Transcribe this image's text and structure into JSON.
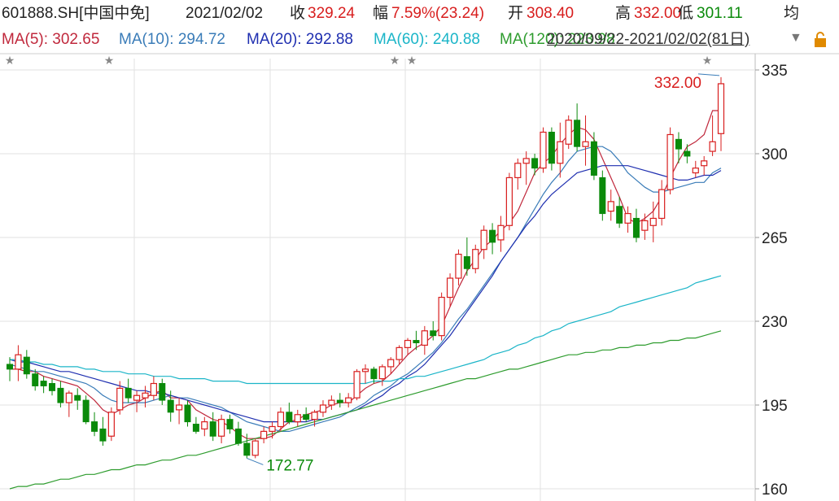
{
  "header": {
    "code": "601888.SH[中国中免]",
    "date": "2021/02/02",
    "close_label": "收",
    "close": "329.24",
    "change_label": "幅",
    "change": "7.59%(23.24)",
    "open_label": "开",
    "open": "308.40",
    "high_label": "高",
    "high": "332.00",
    "low_label": "低",
    "low": "301.11",
    "avg_label": "均"
  },
  "ma_legend": {
    "ma5": "MA(5): 302.65",
    "ma10": "MA(10): 294.72",
    "ma20": "MA(20): 292.88",
    "ma60": "MA(60): 240.88",
    "ma120": "MA(120): 223.98",
    "range": "2020/09/22-2021/02/02(81日)"
  },
  "colors": {
    "up": "#d81e1e",
    "down": "#0a8a0a",
    "ma5": "#c0283c",
    "ma10": "#3a7cb8",
    "ma20": "#1f2fb0",
    "ma60": "#1bb5c8",
    "ma120": "#2e9c2e",
    "grid": "#e2e2e2"
  },
  "icons": {
    "dropdown": "triangle-down-icon",
    "lock": "lock-icon",
    "star": "star-icon"
  },
  "chart_data": {
    "type": "candlestick",
    "ylim": [
      160,
      335
    ],
    "yticks": [
      "335",
      "300",
      "265",
      "230",
      "195",
      "160"
    ],
    "high_annotation": "332.00",
    "low_annotation": "172.77",
    "candles": [
      [
        212,
        215,
        205,
        210
      ],
      [
        210,
        220,
        205,
        216
      ],
      [
        215,
        218,
        206,
        208
      ],
      [
        208,
        210,
        201,
        203
      ],
      [
        205,
        207,
        200,
        203
      ],
      [
        204,
        206,
        199,
        201
      ],
      [
        202,
        205,
        194,
        196
      ],
      [
        196,
        201,
        190,
        200
      ],
      [
        199,
        202,
        193,
        197
      ],
      [
        197,
        199,
        187,
        188
      ],
      [
        188,
        192,
        182,
        184
      ],
      [
        185,
        190,
        178,
        180
      ],
      [
        182,
        194,
        180,
        192
      ],
      [
        193,
        205,
        191,
        202
      ],
      [
        202,
        206,
        196,
        198
      ],
      [
        197,
        201,
        192,
        199
      ],
      [
        198,
        203,
        194,
        200
      ],
      [
        199,
        207,
        197,
        204
      ],
      [
        204,
        206,
        195,
        197
      ],
      [
        197,
        201,
        188,
        192
      ],
      [
        193,
        198,
        187,
        195
      ],
      [
        195,
        197,
        186,
        188
      ],
      [
        187,
        190,
        183,
        184
      ],
      [
        185,
        190,
        182,
        188
      ],
      [
        188,
        192,
        180,
        182
      ],
      [
        182,
        191,
        179,
        189
      ],
      [
        189,
        191,
        183,
        185
      ],
      [
        185,
        188,
        178,
        179
      ],
      [
        179,
        183,
        172.77,
        174
      ],
      [
        174,
        181,
        172.77,
        180
      ],
      [
        181,
        186,
        179,
        184
      ],
      [
        184,
        188,
        181,
        186
      ],
      [
        186,
        194,
        184,
        192
      ],
      [
        192,
        196,
        187,
        188
      ],
      [
        188,
        193,
        186,
        191
      ],
      [
        191,
        194,
        188,
        189
      ],
      [
        189,
        193,
        186,
        192
      ],
      [
        192,
        197,
        190,
        195
      ],
      [
        195,
        199,
        193,
        197
      ],
      [
        197,
        200,
        194,
        196
      ],
      [
        196,
        200,
        194,
        198
      ],
      [
        198,
        210,
        197,
        209
      ],
      [
        209,
        212,
        204,
        210
      ],
      [
        210,
        211,
        204,
        206
      ],
      [
        206,
        212,
        203,
        211
      ],
      [
        211,
        215,
        208,
        214
      ],
      [
        214,
        220,
        212,
        219
      ],
      [
        219,
        223,
        216,
        222
      ],
      [
        222,
        226,
        218,
        221
      ],
      [
        220,
        228,
        216,
        226
      ],
      [
        226,
        230,
        222,
        224
      ],
      [
        224,
        242,
        222,
        240
      ],
      [
        240,
        250,
        236,
        248
      ],
      [
        248,
        260,
        245,
        258
      ],
      [
        257,
        265,
        249,
        252
      ],
      [
        252,
        262,
        250,
        260
      ],
      [
        260,
        270,
        256,
        268
      ],
      [
        268,
        271,
        258,
        263
      ],
      [
        264,
        274,
        259,
        270
      ],
      [
        270,
        292,
        268,
        290
      ],
      [
        290,
        298,
        285,
        296
      ],
      [
        296,
        301,
        287,
        298
      ],
      [
        298,
        300,
        291,
        294
      ],
      [
        294,
        311,
        292,
        309
      ],
      [
        309,
        311,
        293,
        296
      ],
      [
        296,
        313,
        290,
        305
      ],
      [
        304,
        316,
        302,
        314
      ],
      [
        314,
        321,
        301,
        303
      ],
      [
        303,
        316,
        295,
        305
      ],
      [
        305,
        309,
        289,
        291
      ],
      [
        290,
        293,
        272,
        275
      ],
      [
        276,
        285,
        272,
        280
      ],
      [
        278,
        282,
        269,
        271
      ],
      [
        271,
        278,
        267,
        275
      ],
      [
        273,
        277,
        263,
        265
      ],
      [
        268,
        275,
        264,
        272
      ],
      [
        270,
        280,
        263,
        273
      ],
      [
        273,
        289,
        270,
        285
      ],
      [
        285,
        311,
        283,
        308
      ],
      [
        306,
        309,
        296,
        302
      ],
      [
        301,
        304,
        296,
        299
      ],
      [
        292,
        297,
        290,
        294
      ],
      [
        295,
        299,
        291,
        297
      ],
      [
        301,
        316,
        299,
        305
      ],
      [
        308.4,
        332.0,
        301.11,
        329.24
      ]
    ],
    "series": [
      {
        "name": "MA(5)",
        "values": [
          210,
          210,
          209,
          209,
          207,
          206,
          205,
          204,
          203,
          200,
          197,
          193,
          191,
          193,
          195,
          196,
          198,
          200,
          201,
          198,
          198,
          197,
          193,
          191,
          189,
          188,
          186,
          183,
          181,
          181,
          181,
          182,
          185,
          188,
          189,
          191,
          192,
          193,
          195,
          196,
          196,
          199,
          202,
          204,
          205,
          208,
          212,
          216,
          219,
          221,
          224,
          228,
          236,
          244,
          251,
          256,
          261,
          264,
          268,
          271,
          276,
          284,
          292,
          296,
          299,
          304,
          308,
          311,
          310,
          306,
          298,
          290,
          282,
          273,
          271,
          273,
          276,
          282,
          290,
          297,
          303,
          305,
          308,
          318,
          318
        ]
      },
      {
        "name": "MA(10)",
        "values": [
          212,
          211,
          210,
          209,
          209,
          208,
          207,
          206,
          205,
          204,
          202,
          199,
          197,
          196,
          196,
          196,
          196,
          197,
          198,
          199,
          198,
          198,
          197,
          196,
          195,
          194,
          192,
          190,
          188,
          187,
          186,
          185,
          184,
          184,
          185,
          186,
          187,
          188,
          189,
          190,
          192,
          194,
          196,
          199,
          201,
          203,
          206,
          208,
          211,
          214,
          217,
          221,
          226,
          231,
          235,
          240,
          245,
          250,
          255,
          260,
          265,
          271,
          277,
          283,
          288,
          292,
          297,
          301,
          302,
          303,
          303,
          301,
          297,
          292,
          289,
          286,
          284,
          284,
          285,
          286,
          287,
          288,
          288,
          292,
          294
        ]
      },
      {
        "name": "MA(20)",
        "values": [
          214,
          213,
          213,
          212,
          211,
          210,
          209,
          209,
          208,
          207,
          206,
          205,
          204,
          203,
          202,
          201,
          201,
          200,
          200,
          199,
          198,
          197,
          196,
          195,
          194,
          193,
          192,
          191,
          190,
          189,
          188,
          188,
          188,
          188,
          188,
          188,
          189,
          189,
          190,
          191,
          192,
          193,
          195,
          197,
          199,
          202,
          204,
          207,
          209,
          212,
          216,
          220,
          224,
          229,
          234,
          239,
          244,
          249,
          255,
          260,
          265,
          270,
          274,
          279,
          283,
          286,
          289,
          292,
          293,
          294,
          295,
          295,
          295,
          295,
          294,
          293,
          292,
          291,
          290,
          289,
          289,
          290,
          291,
          291,
          293
        ]
      },
      {
        "name": "MA(60)",
        "values": [
          214,
          214,
          213,
          213,
          212,
          212,
          211,
          211,
          211,
          210,
          210,
          209,
          209,
          209,
          208,
          208,
          208,
          207,
          207,
          207,
          206,
          206,
          206,
          206,
          205,
          205,
          205,
          205,
          204,
          204,
          204,
          204,
          204,
          204,
          204,
          204,
          204,
          204,
          204,
          204,
          204,
          204,
          204,
          205,
          205,
          205,
          206,
          206,
          207,
          207,
          208,
          209,
          210,
          211,
          212,
          213,
          214,
          216,
          217,
          218,
          220,
          221,
          223,
          224,
          226,
          227,
          229,
          230,
          231,
          232,
          233,
          234,
          236,
          237,
          238,
          239,
          240,
          241,
          242,
          243,
          244,
          246,
          247,
          248,
          249
        ]
      },
      {
        "name": "MA(120)",
        "values": [
          160,
          161,
          161,
          162,
          162,
          163,
          164,
          164,
          165,
          166,
          166,
          167,
          168,
          168,
          169,
          170,
          170,
          171,
          172,
          172,
          173,
          174,
          174,
          175,
          176,
          177,
          178,
          179,
          180,
          181,
          182,
          183,
          184,
          185,
          186,
          187,
          188,
          189,
          190,
          191,
          192,
          193,
          194,
          195,
          196,
          197,
          198,
          199,
          200,
          201,
          202,
          203,
          204,
          205,
          206,
          206,
          207,
          208,
          209,
          210,
          210,
          211,
          212,
          213,
          214,
          215,
          216,
          216,
          217,
          217,
          218,
          218,
          219,
          219,
          220,
          220,
          221,
          221,
          222,
          222,
          223,
          223,
          224,
          225,
          226
        ]
      }
    ]
  }
}
